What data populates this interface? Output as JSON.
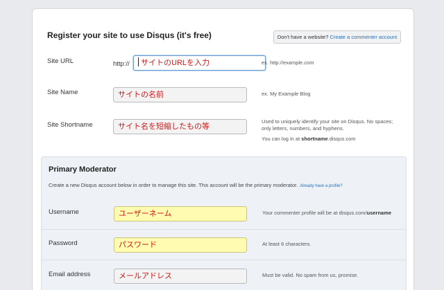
{
  "page": {
    "title": "Register your site to use Disqus (it's free)",
    "commenter_prompt": "Don't have a website?",
    "commenter_link": "Create a commenter account"
  },
  "site_fields": [
    {
      "label": "Site URL",
      "prefix": "http://",
      "value": "サイトのURLを入力",
      "hint": "ex. http://example.com"
    },
    {
      "label": "Site Name",
      "value": "サイトの名前",
      "hint": "ex. My Example Blog"
    },
    {
      "label": "Site Shortname",
      "value": "サイト名を短縮したもの等",
      "hint_lines": [
        "Used to uniquely identify your site on Disqus. No spaces;",
        "only letters, numbers, and hyphens."
      ],
      "hint_shortname_pre": "You can log in at",
      "hint_shortname_bold": "shortname",
      "hint_shortname_post": ".disqus.com"
    }
  ],
  "moderator": {
    "title": "Primary Moderator",
    "description": "Create a new Disqus account below in order to manage this site. This account will be the primary moderator.",
    "profile_link": "Already have a profile?",
    "fields": [
      {
        "label": "Username",
        "value": "ユーザーネーム",
        "hint_pre": "Your commenter profile will be at disqus.com/",
        "hint_bold": "username"
      },
      {
        "label": "Password",
        "value": "パスワード",
        "hint": "At least 6 characters."
      },
      {
        "label": "Email address",
        "value": "メールアドレス",
        "hint": "Must be valid. No spam from us, promise."
      }
    ]
  },
  "colors": {
    "link": "#2a6eb5",
    "field_text": "#d01818",
    "highlight_field": "#fffbb0",
    "section_bg": "#eef2f6"
  }
}
